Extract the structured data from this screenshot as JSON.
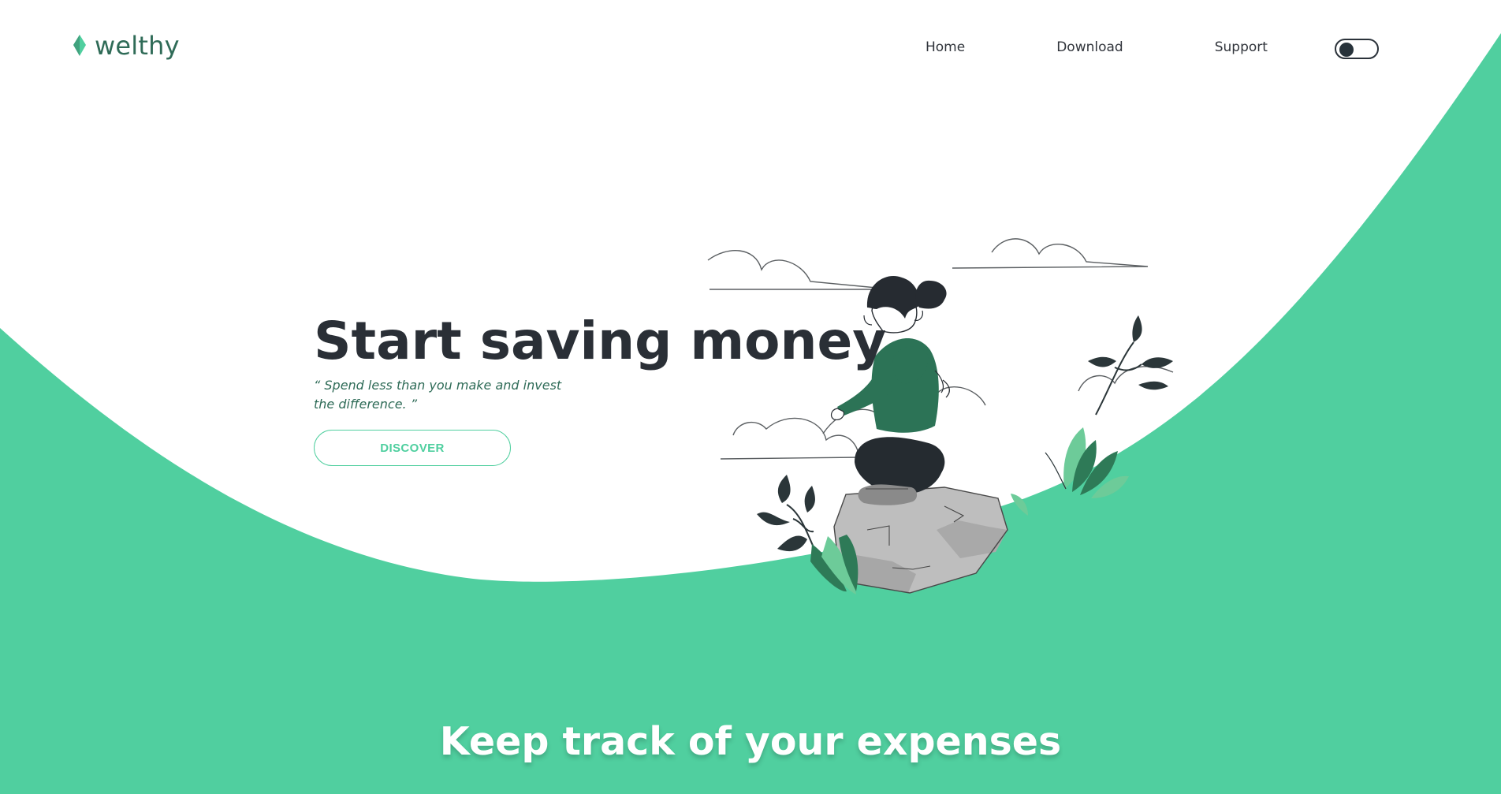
{
  "brand": {
    "name": "welthy",
    "logo_icon": "droplet-leaf-icon"
  },
  "nav": {
    "items": [
      "Home",
      "Download",
      "Support"
    ]
  },
  "theme_toggle": {
    "icon": "moon-icon"
  },
  "hero": {
    "title": "Start saving money",
    "quote": "“ Spend less than you make and invest the difference. ”",
    "cta": "DISCOVER"
  },
  "section": {
    "title": "Keep track of your expenses"
  },
  "colors": {
    "accent": "#50CF9F",
    "dark": "#2A2F36",
    "brand_text": "#2E6B57"
  }
}
